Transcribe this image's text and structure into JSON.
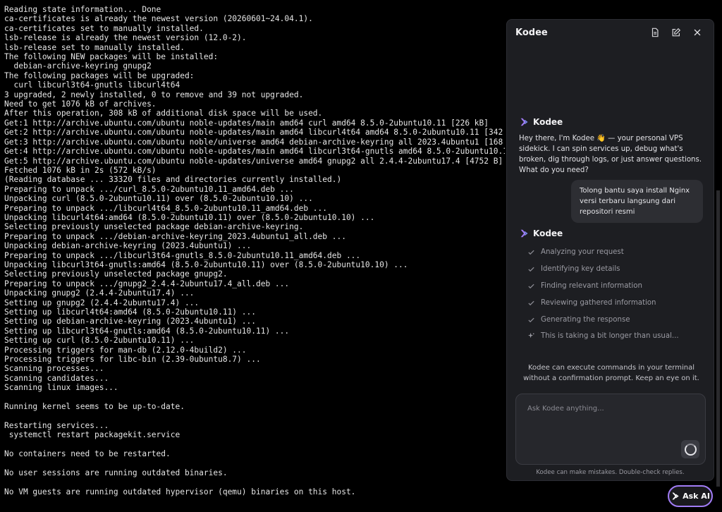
{
  "terminal": {
    "lines": [
      "Reading state information... Done",
      "ca-certificates is already the newest version (20260601~24.04.1).",
      "ca-certificates set to manually installed.",
      "lsb-release is already the newest version (12.0-2).",
      "lsb-release set to manually installed.",
      "The following NEW packages will be installed:",
      "  debian-archive-keyring gnupg2",
      "The following packages will be upgraded:",
      "  curl libcurl3t64-gnutls libcurl4t64",
      "3 upgraded, 2 newly installed, 0 to remove and 39 not upgraded.",
      "Need to get 1076 kB of archives.",
      "After this operation, 308 kB of additional disk space will be used.",
      "Get:1 http://archive.ubuntu.com/ubuntu noble-updates/main amd64 curl amd64 8.5.0-2ubuntu10.11 [226 kB]",
      "Get:2 http://archive.ubuntu.com/ubuntu noble-updates/main amd64 libcurl4t64 amd64 8.5.0-2ubuntu10.11 [342",
      "Get:3 http://archive.ubuntu.com/ubuntu noble/universe amd64 debian-archive-keyring all 2023.4ubuntu1 [168",
      "Get:4 http://archive.ubuntu.com/ubuntu noble-updates/main amd64 libcurl3t64-gnutls amd64 8.5.0-2ubuntu10.1",
      "Get:5 http://archive.ubuntu.com/ubuntu noble-updates/universe amd64 gnupg2 all 2.4.4-2ubuntu17.4 [4752 B]",
      "Fetched 1076 kB in 2s (572 kB/s)",
      "(Reading database ... 33320 files and directories currently installed.)",
      "Preparing to unpack .../curl_8.5.0-2ubuntu10.11_amd64.deb ...",
      "Unpacking curl (8.5.0-2ubuntu10.11) over (8.5.0-2ubuntu10.10) ...",
      "Preparing to unpack .../libcurl4t64_8.5.0-2ubuntu10.11_amd64.deb ...",
      "Unpacking libcurl4t64:amd64 (8.5.0-2ubuntu10.11) over (8.5.0-2ubuntu10.10) ...",
      "Selecting previously unselected package debian-archive-keyring.",
      "Preparing to unpack .../debian-archive-keyring_2023.4ubuntu1_all.deb ...",
      "Unpacking debian-archive-keyring (2023.4ubuntu1) ...",
      "Preparing to unpack .../libcurl3t64-gnutls_8.5.0-2ubuntu10.11_amd64.deb ...",
      "Unpacking libcurl3t64-gnutls:amd64 (8.5.0-2ubuntu10.11) over (8.5.0-2ubuntu10.10) ...",
      "Selecting previously unselected package gnupg2.",
      "Preparing to unpack .../gnupg2_2.4.4-2ubuntu17.4_all.deb ...",
      "Unpacking gnupg2 (2.4.4-2ubuntu17.4) ...",
      "Setting up gnupg2 (2.4.4-2ubuntu17.4) ...",
      "Setting up libcurl4t64:amd64 (8.5.0-2ubuntu10.11) ...",
      "Setting up debian-archive-keyring (2023.4ubuntu1) ...",
      "Setting up libcurl3t64-gnutls:amd64 (8.5.0-2ubuntu10.11) ...",
      "Setting up curl (8.5.0-2ubuntu10.11) ...",
      "Processing triggers for man-db (2.12.0-4build2) ...",
      "Processing triggers for libc-bin (2.39-0ubuntu8.7) ...",
      "Scanning processes...",
      "Scanning candidates...",
      "Scanning linux images...",
      "",
      "Running kernel seems to be up-to-date.",
      "",
      "Restarting services...",
      " systemctl restart packagekit.service",
      "",
      "No containers need to be restarted.",
      "",
      "No user sessions are running outdated binaries.",
      "",
      "No VM guests are running outdated hypervisor (qemu) binaries on this host."
    ]
  },
  "panel": {
    "title": "Kodee",
    "header_icons": [
      "note-icon",
      "edit-icon",
      "close-icon"
    ],
    "bot_name": "Kodee",
    "greeting": "Hey there, I'm Kodee 👋 — your personal VPS sidekick. I can spin services up, debug what's broken, dig through logs, or just answer questions. What do you need?",
    "user_message": "Tolong bantu saya install Nginx versi terbaru langsung dari repositori resmi",
    "steps": [
      {
        "label": "Analyzing your request",
        "icon": "check-icon"
      },
      {
        "label": "Identifying key details",
        "icon": "check-icon"
      },
      {
        "label": "Finding relevant information",
        "icon": "check-icon"
      },
      {
        "label": "Reviewing gathered information",
        "icon": "check-icon"
      },
      {
        "label": "Generating the response",
        "icon": "check-icon"
      },
      {
        "label": "This is taking a bit longer than usual...",
        "icon": "sparkle-icon"
      }
    ],
    "warning": "Kodee can execute commands in your terminal without a confirmation prompt. Keep an eye on it.",
    "input_placeholder": "Ask Kodee anything...",
    "disclaimer": "Kodee can make mistakes. Double-check replies."
  },
  "ask_ai": {
    "label": "Ask AI"
  },
  "colors": {
    "panel_bg": "#1d1e22",
    "accent": "#a17cf5",
    "terminal_text": "#e6e6e6"
  }
}
